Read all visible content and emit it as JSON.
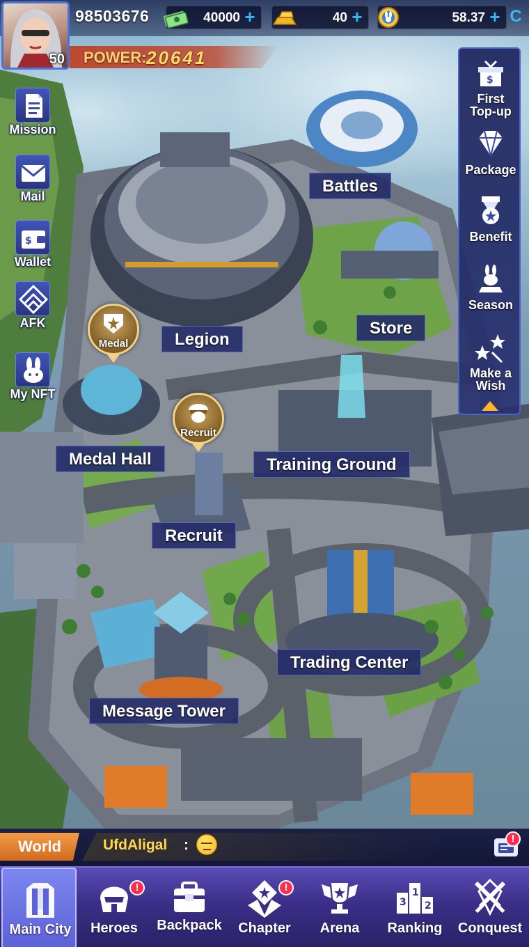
{
  "player": {
    "id": "98503676",
    "level": "50",
    "power_label": "POWER:",
    "power_value": "20641"
  },
  "resources": [
    {
      "icon": "cash-icon",
      "value": "40000"
    },
    {
      "icon": "gold-bar-icon",
      "value": "40"
    },
    {
      "icon": "bunny-coin-icon",
      "value": "58.37"
    }
  ],
  "left_menu": [
    {
      "name": "mission",
      "label": "Mission",
      "icon": "document-icon"
    },
    {
      "name": "mail",
      "label": "Mail",
      "icon": "envelope-icon"
    },
    {
      "name": "wallet",
      "label": "Wallet",
      "icon": "wallet-icon"
    },
    {
      "name": "afk",
      "label": "AFK",
      "icon": "afk-icon"
    },
    {
      "name": "my-nft",
      "label": "My NFT",
      "icon": "bunny-icon"
    }
  ],
  "right_menu": [
    {
      "name": "first-topup",
      "label_line1": "First",
      "label_line2": "Top-up",
      "icon": "gift-icon"
    },
    {
      "name": "package",
      "label": "Package",
      "icon": "diamond-icon"
    },
    {
      "name": "benefit",
      "label": "Benefit",
      "icon": "medal-ribbon-icon"
    },
    {
      "name": "season",
      "label": "Season",
      "icon": "bunny-pedestal-icon"
    },
    {
      "name": "make-a-wish",
      "label_line1": "Make a",
      "label_line2": "Wish",
      "icon": "stars-icon"
    }
  ],
  "map_labels": {
    "battles": "Battles",
    "store": "Store",
    "legion": "Legion",
    "medal_hall": "Medal Hall",
    "training_ground": "Training Ground",
    "recruit": "Recruit",
    "trading_center": "Trading Center",
    "message_tower": "Message Tower"
  },
  "map_badges": {
    "medal": "Medal",
    "recruit": "Recruit"
  },
  "chat": {
    "channel": "World",
    "user": "UfdAligal",
    "separator": ":",
    "notification": "!"
  },
  "nav": [
    {
      "name": "main-city",
      "label": "Main City",
      "active": true
    },
    {
      "name": "heroes",
      "label": "Heroes",
      "alert": "!"
    },
    {
      "name": "backpack",
      "label": "Backpack"
    },
    {
      "name": "chapter",
      "label": "Chapter",
      "alert": "!"
    },
    {
      "name": "arena",
      "label": "Arena"
    },
    {
      "name": "ranking",
      "label": "Ranking"
    },
    {
      "name": "conquest",
      "label": "Conquest"
    }
  ],
  "colors": {
    "accent_blue": "#35b9f5",
    "power_orange": "#d16a1f",
    "alert_red": "#ff2d50",
    "nav_purple": "#3a2f88"
  }
}
